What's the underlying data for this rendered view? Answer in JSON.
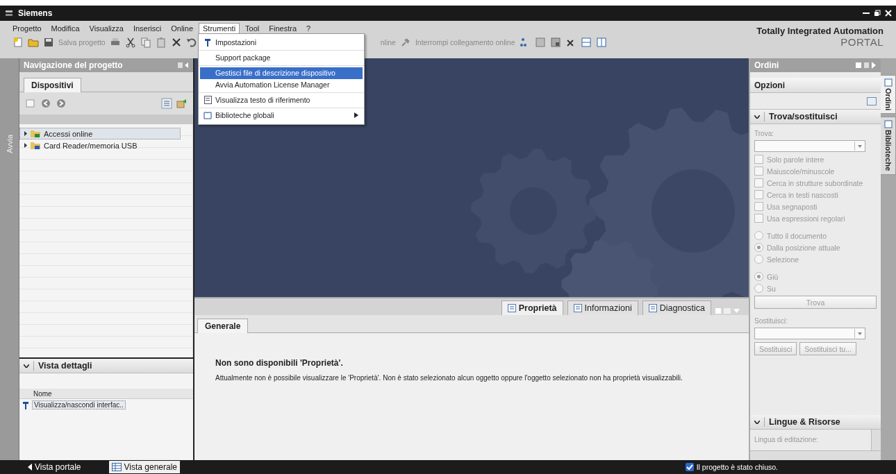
{
  "window": {
    "title": "Siemens"
  },
  "menu": [
    {
      "label": "Progetto",
      "selected": false
    },
    {
      "label": "Modifica",
      "selected": false
    },
    {
      "label": "Visualizza",
      "selected": false
    },
    {
      "label": "Inserisci",
      "selected": false
    },
    {
      "label": "Online",
      "selected": false
    },
    {
      "label": "Strumenti",
      "selected": true
    },
    {
      "label": "Tool",
      "selected": false
    },
    {
      "label": "Finestra",
      "selected": false
    },
    {
      "label": "?",
      "selected": false
    }
  ],
  "dropdown": {
    "groups": [
      [
        {
          "label": "Impostazioni",
          "selected": false,
          "submenu": false
        }
      ],
      [
        {
          "label": "Support package",
          "selected": false,
          "submenu": false
        }
      ],
      [
        {
          "label": "Gestisci file di descrizione dispositivo",
          "selected": true,
          "submenu": false
        },
        {
          "label": "Avvia Automation License Manager",
          "selected": false,
          "submenu": false
        }
      ],
      [
        {
          "label": "Visualizza testo di riferimento",
          "selected": false,
          "submenu": false
        }
      ],
      [
        {
          "label": "Biblioteche globali",
          "selected": false,
          "submenu": true
        }
      ]
    ]
  },
  "toolbar": {
    "save_label": "Salva progetto",
    "online_label": "nline",
    "disconnect_label": "Interrompi collegamento online"
  },
  "brand": {
    "line1": "Totally Integrated Automation",
    "line2": "PORTAL"
  },
  "start_tab": "Avvia",
  "navigation": {
    "title": "Navigazione del progetto",
    "tab": "Dispositivi",
    "tree": [
      {
        "label": "Accessi online",
        "expanded": false,
        "selected": true
      },
      {
        "label": "Card Reader/memoria USB",
        "expanded": false,
        "selected": false
      }
    ]
  },
  "details": {
    "title": "Vista dettagli",
    "expanded": true,
    "column": "Nome",
    "rows": [
      {
        "label": "Visualizza/nascondi interfac..",
        "selected": true
      }
    ]
  },
  "inspector": {
    "tabs": [
      {
        "label": "Proprietà",
        "selected": true
      },
      {
        "label": "Informazioni",
        "selected": false
      },
      {
        "label": "Diagnostica",
        "selected": false
      }
    ],
    "subtab": "Generale",
    "heading": "Non sono disponibili 'Proprietà'.",
    "message": "Attualmente non è possibile visualizzare le 'Proprietà'. Non è stato selezionato alcun oggetto oppure l'oggetto selezionato non ha proprietà visualizzabili."
  },
  "tasks": {
    "title": "Ordini",
    "options_title": "Opzioni",
    "find": {
      "title": "Trova/sostituisci",
      "expanded": true,
      "disabled": true,
      "find_label": "Trova:",
      "checks": [
        {
          "label": "Solo parole intere",
          "checked": false
        },
        {
          "label": "Maiuscole/minuscole",
          "checked": false
        },
        {
          "label": "Cerca in strutture subordinate",
          "checked": false
        },
        {
          "label": "Cerca in testi nascosti",
          "checked": false
        },
        {
          "label": "Usa segnaposti",
          "checked": false
        },
        {
          "label": "Usa espressioni regolari",
          "checked": false
        }
      ],
      "scope": [
        {
          "label": "Tutto il documento",
          "selected": false
        },
        {
          "label": "Dalla posizione attuale",
          "selected": true
        },
        {
          "label": "Selezione",
          "selected": false
        }
      ],
      "direction": [
        {
          "label": "Giù",
          "selected": true
        },
        {
          "label": "Su",
          "selected": false
        }
      ],
      "find_button": "Trova",
      "replace_label": "Sostituisci:",
      "replace_buttons": [
        "Sostituisci",
        "Sostituisci tu..."
      ]
    },
    "languages": {
      "title": "Lingue & Risorse",
      "expanded": true,
      "label": "Lingua di editazione:"
    }
  },
  "side_tabs": [
    {
      "label": "Ordini",
      "selected": true
    },
    {
      "label": "Biblioteche",
      "selected": false
    }
  ],
  "status_bar": {
    "views": [
      {
        "label": "Vista portale",
        "selected": false
      },
      {
        "label": "Vista generale",
        "selected": true
      }
    ],
    "message": "Il progetto è stato chiuso."
  }
}
